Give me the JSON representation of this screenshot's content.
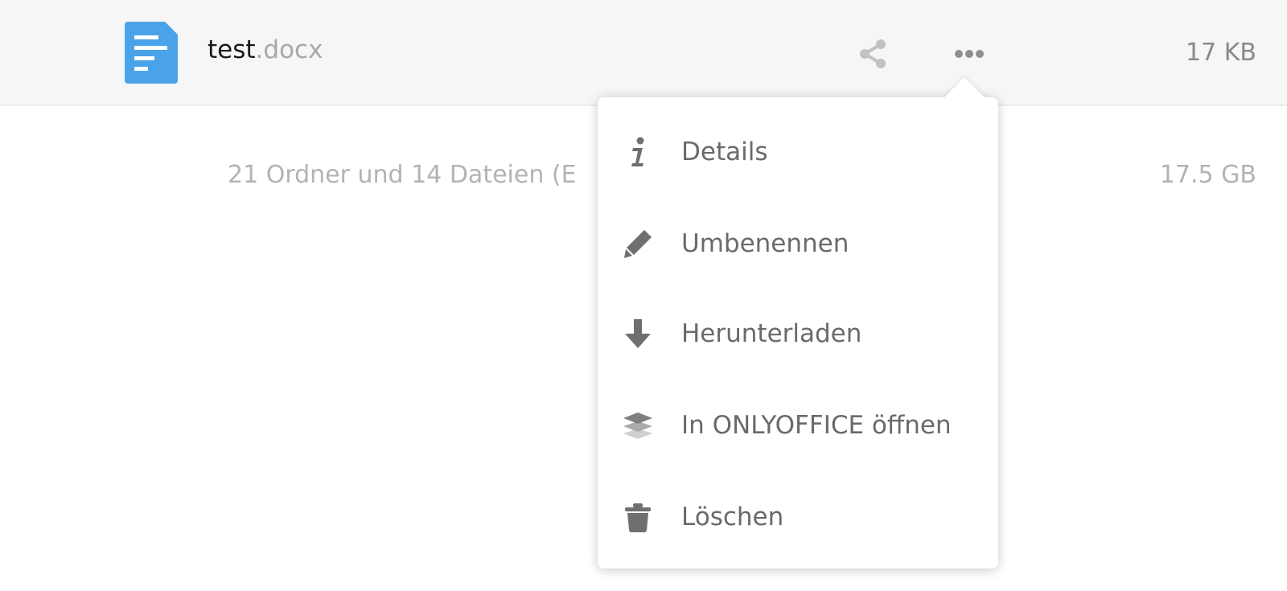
{
  "file": {
    "name_base": "test",
    "name_ext": ".docx",
    "size": "17 KB",
    "icon": "document-icon",
    "icon_color": "#4aa3e8"
  },
  "actions": {
    "share_icon": "share-icon",
    "more_icon": "more-icon"
  },
  "summary": {
    "text": "21 Ordner und 14 Dateien (E",
    "size": "17.5 GB"
  },
  "menu": {
    "items": [
      {
        "label": "Details",
        "icon": "info-icon"
      },
      {
        "label": "Umbenennen",
        "icon": "pencil-icon"
      },
      {
        "label": "Herunterladen",
        "icon": "download-icon"
      },
      {
        "label": "In ONLYOFFICE öffnen",
        "icon": "onlyoffice-icon"
      },
      {
        "label": "Löschen",
        "icon": "trash-icon"
      }
    ]
  }
}
